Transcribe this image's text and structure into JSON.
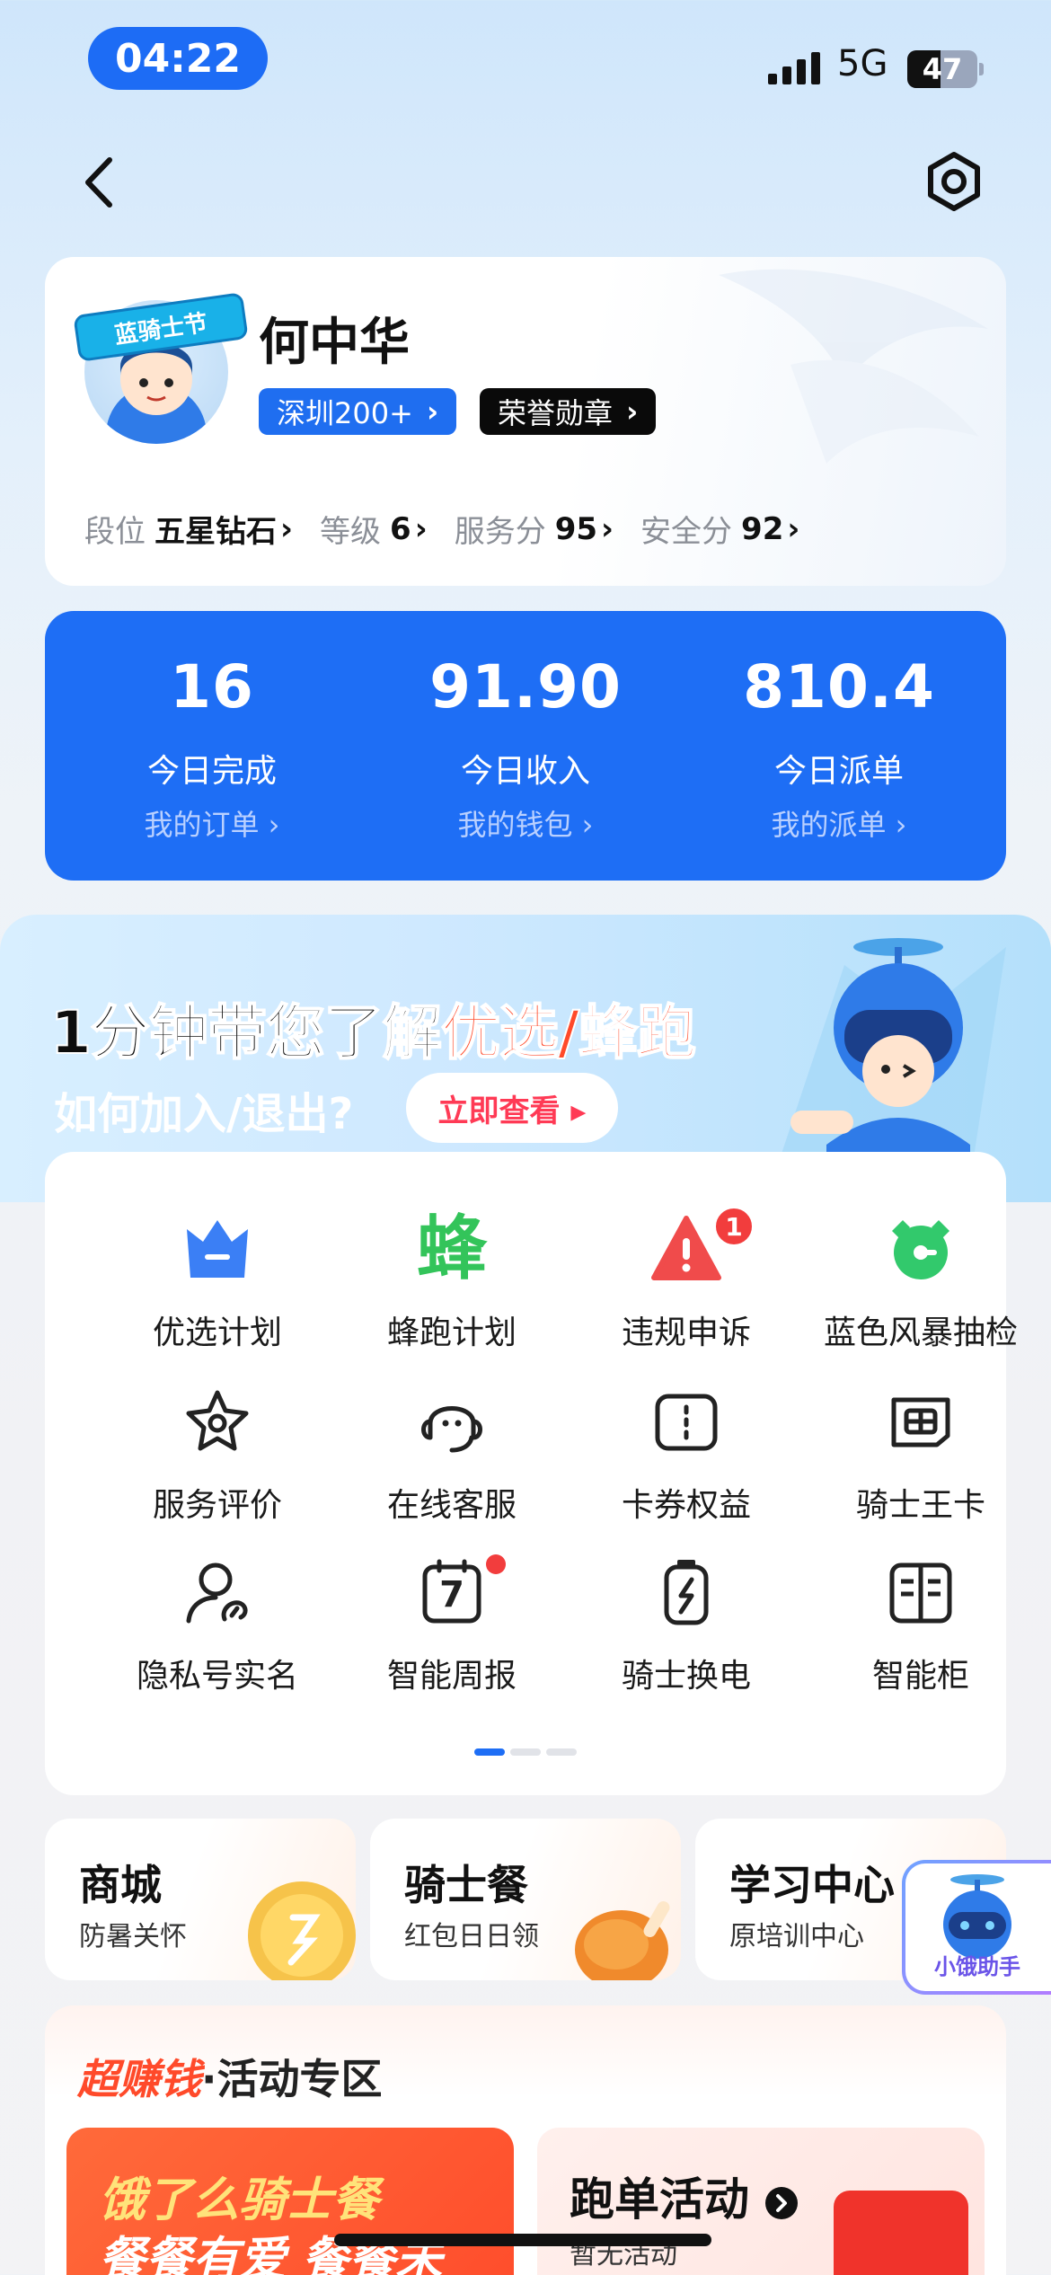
{
  "status_bar": {
    "time": "04:22",
    "network": "5G",
    "battery": "47",
    "battery_level": 0.47
  },
  "profile": {
    "name": "何中华",
    "avatar_badge": "蓝骑士节",
    "city_tag": "深圳200+",
    "medal_tag": "荣誉勋章",
    "stats": [
      {
        "key": "段位",
        "value": "五星钻石"
      },
      {
        "key": "等级",
        "value": "6"
      },
      {
        "key": "服务分",
        "value": "95"
      },
      {
        "key": "安全分",
        "value": "92"
      }
    ]
  },
  "summary": [
    {
      "value": "16",
      "label": "今日完成",
      "link": "我的订单 ›"
    },
    {
      "value": "91.90",
      "label": "今日收入",
      "link": "我的钱包 ›"
    },
    {
      "value": "810.4",
      "label": "今日派单",
      "link": "我的派单 ›"
    }
  ],
  "banner": {
    "title_a": "1分钟带您了解",
    "title_b": "优选/蜂跑",
    "subtitle": "如何加入/退出?",
    "button": "立即查看 ▸"
  },
  "menu": {
    "items": [
      {
        "label": "优选计划",
        "icon": "crown-icon"
      },
      {
        "label": "蜂跑计划",
        "icon": "bee-icon",
        "glyph": "蜂"
      },
      {
        "label": "违规申诉",
        "icon": "warning-icon",
        "badge": "1"
      },
      {
        "label": "蓝色风暴抽检",
        "icon": "alarm-clock-icon"
      },
      {
        "label": "服务评价",
        "icon": "star-icon"
      },
      {
        "label": "在线客服",
        "icon": "headset-icon"
      },
      {
        "label": "卡券权益",
        "icon": "coupon-icon"
      },
      {
        "label": "骑士王卡",
        "icon": "card-icon"
      },
      {
        "label": "隐私号实名",
        "icon": "privacy-user-icon"
      },
      {
        "label": "智能周报",
        "icon": "calendar-icon",
        "glyph": "7"
      },
      {
        "label": "骑士换电",
        "icon": "battery-swap-icon"
      },
      {
        "label": "智能柜",
        "icon": "cabinet-icon"
      }
    ],
    "pages": 3,
    "active_page": 1
  },
  "mini_cards": [
    {
      "title": "商城",
      "subtitle": "防暑关怀"
    },
    {
      "title": "骑士餐",
      "subtitle": "红包日日领"
    },
    {
      "title": "学习中心",
      "subtitle": "原培训中心"
    }
  ],
  "helper": {
    "label": "小饿助手"
  },
  "activity": {
    "title_hot": "超赚钱",
    "title_rest": "·活动专区",
    "left_line1": "饿了么骑士餐",
    "left_line2": "餐餐有爱 餐餐未",
    "right_title": "跑单活动",
    "right_sub": "暂无活动"
  },
  "colors": {
    "primary": "#1e6ef5",
    "accent_red": "#ff4a2a",
    "badge_red": "#f23d3d"
  }
}
